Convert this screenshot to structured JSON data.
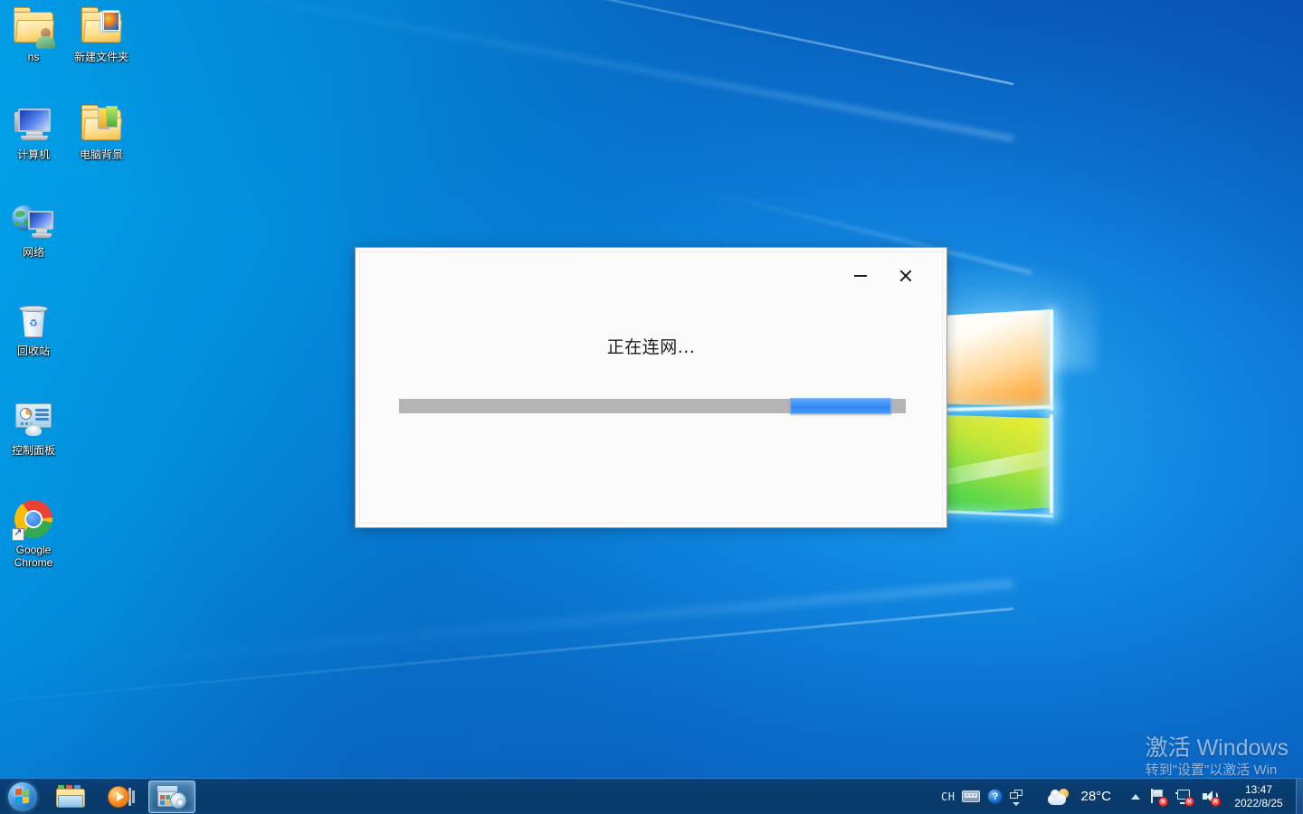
{
  "desktop": {
    "icons": [
      {
        "label": "ns",
        "type": "folder-user"
      },
      {
        "label": "新建文件夹",
        "type": "folder-pictures"
      },
      {
        "label": "计算机",
        "type": "computer"
      },
      {
        "label": "电脑背景",
        "type": "folder-wallpapers"
      },
      {
        "label": "网络",
        "type": "network"
      },
      {
        "label": "回收站",
        "type": "recycle-bin"
      },
      {
        "label": "控制面板",
        "type": "control-panel"
      },
      {
        "label": "Google Chrome",
        "label_line1": "Google",
        "label_line2": "Chrome",
        "type": "chrome"
      }
    ]
  },
  "dialog": {
    "status_text": "正在连网...",
    "minimize_label": "−",
    "close_label": "✕",
    "progress": {
      "style": "marquee",
      "track_color": "#b4b4b4",
      "chunk_color": "#3a8ef6",
      "chunk_position_percent": 77,
      "chunk_width_percent": 20
    }
  },
  "watermark": {
    "title": "激活 Windows",
    "subtitle": "转到\"设置\"以激活 Win"
  },
  "taskbar": {
    "start_label": "开始",
    "pinned": [
      {
        "name": "file-explorer",
        "label": "文件资源管理器",
        "active": false
      },
      {
        "name": "media-player",
        "label": "Windows Media Player",
        "active": false
      },
      {
        "name": "setup-installer",
        "label": "安装程序",
        "active": true
      }
    ],
    "tray": {
      "ime_label": "CH",
      "help_label": "?",
      "temperature": "28°C",
      "weather_icon": "partly-cloudy-icon",
      "network_status": "disconnected",
      "volume_status": "muted",
      "flag_status": "alert",
      "badge_mark": "✕"
    },
    "clock": {
      "time": "13:47",
      "date": "2022/8/25"
    }
  },
  "colors": {
    "desktop_blue": "#0a78d4",
    "taskbar_blue": "#083a6c",
    "accent_blue": "#3a8ef6",
    "progress_gray": "#b4b4b4",
    "dialog_bg": "#fafafa"
  }
}
